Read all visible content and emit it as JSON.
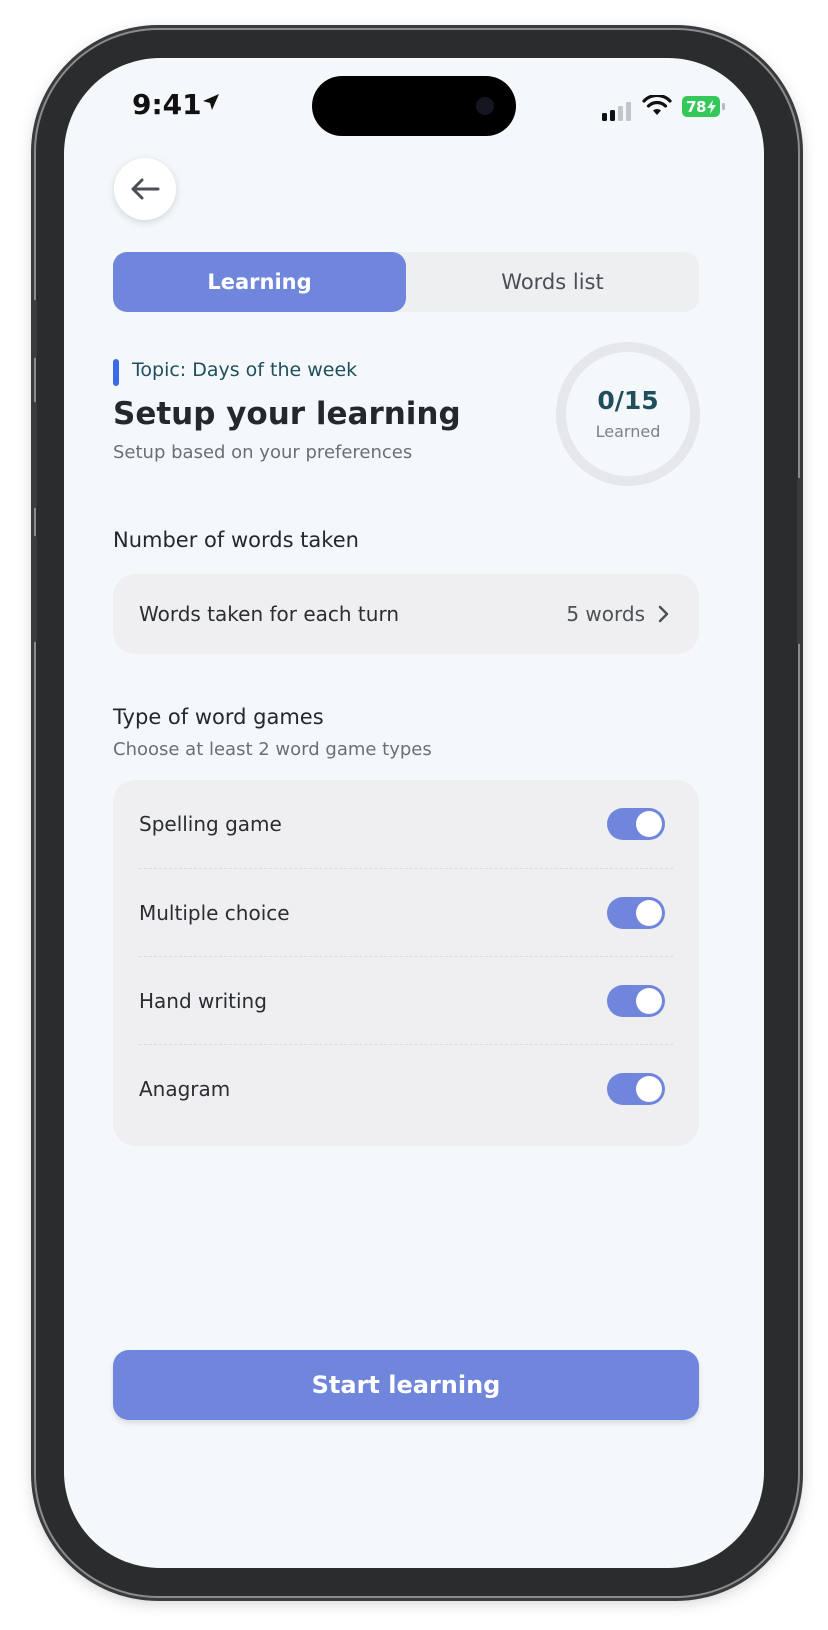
{
  "status_bar": {
    "time": "9:41",
    "battery": "78",
    "battery_color": "#34c759"
  },
  "header": {
    "back_icon": "arrow-left-icon"
  },
  "tabs": [
    {
      "label": "Learning",
      "active": true
    },
    {
      "label": "Words list",
      "active": false
    }
  ],
  "intro": {
    "topic": "Topic: Days of the week",
    "title": "Setup your learning",
    "subtitle": "Setup based on your preferences"
  },
  "progress": {
    "value": "0/15",
    "label": "Learned",
    "fraction": 0
  },
  "words_section": {
    "heading": "Number of words taken",
    "row_label": "Words taken for each turn",
    "row_value": "5 words",
    "row_icon": "chevron-right-icon"
  },
  "games_section": {
    "heading": "Type of word games",
    "subheading": "Choose at least 2 word game types",
    "games": [
      {
        "label": "Spelling game",
        "enabled": true
      },
      {
        "label": "Multiple choice",
        "enabled": true
      },
      {
        "label": "Hand writing",
        "enabled": true
      },
      {
        "label": "Anagram",
        "enabled": true
      }
    ]
  },
  "cta": {
    "label": "Start learning"
  },
  "colors": {
    "accent": "#6f86dc",
    "topic_marker": "#3b6ae8",
    "topic_text": "#1f4f5c"
  }
}
